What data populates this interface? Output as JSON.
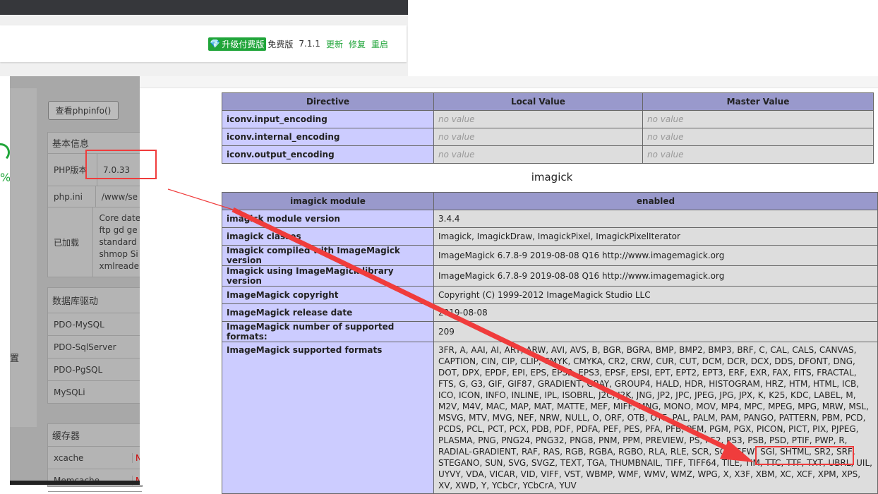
{
  "header": {
    "upgrade_label": "升级付费版",
    "edition": "免费版",
    "version": "7.1.1",
    "update": "更新",
    "repair": "修复",
    "restart": "重启"
  },
  "left_panel": {
    "phpinfo_button": "查看phpinfo()",
    "partial_percent": "%",
    "partial_setting": "置",
    "basic_info": {
      "title": "基本信息",
      "rows": [
        {
          "k": "PHP版本",
          "v": "7.0.33"
        },
        {
          "k": "php.ini",
          "v": "/www/se"
        },
        {
          "k": "已加载",
          "v": "Core date\nftp gd ge\nstandard\nshmop Si\nxmlreade"
        }
      ]
    },
    "db_drivers": {
      "title": "数据库驱动",
      "rows": [
        "PDO-MySQL",
        "PDO-SqlServer",
        "PDO-PgSQL",
        "MySQLi"
      ]
    },
    "cache": {
      "title": "缓存器",
      "rows": [
        "xcache",
        "Memcache"
      ]
    }
  },
  "iconv_table": {
    "headers": [
      "Directive",
      "Local Value",
      "Master Value"
    ],
    "rows": [
      {
        "d": "iconv.input_encoding",
        "l": "no value",
        "m": "no value"
      },
      {
        "d": "iconv.internal_encoding",
        "l": "no value",
        "m": "no value"
      },
      {
        "d": "iconv.output_encoding",
        "l": "no value",
        "m": "no value"
      }
    ]
  },
  "imagick": {
    "title": "imagick",
    "headers": [
      "imagick module",
      "enabled"
    ],
    "rows": [
      {
        "k": "imagick module version",
        "v": "3.4.4"
      },
      {
        "k": "imagick classes",
        "v": "Imagick, ImagickDraw, ImagickPixel, ImagickPixelIterator"
      },
      {
        "k": "Imagick compiled with ImageMagick version",
        "v": "ImageMagick 6.7.8-9 2019-08-08 Q16 http://www.imagemagick.org"
      },
      {
        "k": "Imagick using ImageMagick library version",
        "v": "ImageMagick 6.7.8-9 2019-08-08 Q16 http://www.imagemagick.org"
      },
      {
        "k": "ImageMagick copyright",
        "v": "Copyright (C) 1999-2012 ImageMagick Studio LLC"
      },
      {
        "k": "ImageMagick release date",
        "v": "2019-08-08"
      },
      {
        "k": "ImageMagick number of supported formats:",
        "v": "209"
      },
      {
        "k": "ImageMagick supported formats",
        "v": "3FR, A, AAI, AI, ART, ARW, AVI, AVS, B, BGR, BGRA, BMP, BMP2, BMP3, BRF, C, CAL, CALS, CANVAS, CAPTION, CIN, CIP, CLIP, CMYK, CMYKA, CR2, CRW, CUR, CUT, DCM, DCR, DCX, DDS, DFONT, DNG, DOT, DPX, EPDF, EPI, EPS, EPS2, EPS3, EPSF, EPSI, EPT, EPT2, EPT3, ERF, EXR, FAX, FITS, FRACTAL, FTS, G, G3, GIF, GIF87, GRADIENT, GRAY, GROUP4, HALD, HDR, HISTOGRAM, HRZ, HTM, HTML, ICB, ICO, ICON, INFO, INLINE, IPL, ISOBRL, J2C, J2K, JNG, JP2, JPC, JPEG, JPG, JPX, K, K25, KDC, LABEL, M, M2V, M4V, MAC, MAP, MAT, MATTE, MEF, MIFF, MNG, MONO, MOV, MP4, MPC, MPEG, MPG, MRW, MSL, MSVG, MTV, MVG, NEF, NRW, NULL, O, ORF, OTB, OTF, PAL, PALM, PAM, PANGO, PATTERN, PBM, PCD, PCDS, PCL, PCT, PCX, PDB, PDF, PDFA, PEF, PES, PFA, PFB, PFM, PGM, PGX, PICON, PICT, PIX, PJPEG, PLASMA, PNG, PNG24, PNG32, PNG8, PNM, PPM, PREVIEW, PS, PS2, PS3, PSB, PSD, PTIF, PWP, R, RADIAL-GRADIENT, RAF, RAS, RGB, RGBA, RGBO, RLA, RLE, SCR, SCT, SFW, SGI, SHTML, SR2, SRF, STEGANO, SUN, SVG, SVGZ, TEXT, TGA, THUMBNAIL, TIFF, TIFF64, TILE, TIM, TTC, TTF, TXT, UBRL, UIL, UYVY, VDA, VICAR, VID, VIFF, VST, WBMP, WMF, WMV, WMZ, WPG, X, X3F, XBM, XC, XCF, XPM, XPS, XV, XWD, Y, YCbCr, YCbCrA, YUV"
      }
    ]
  },
  "colors": {
    "accent": "#20a53a",
    "annotation": "#f03c3c",
    "table_header": "#9999cc",
    "table_key": "#ccccff"
  }
}
